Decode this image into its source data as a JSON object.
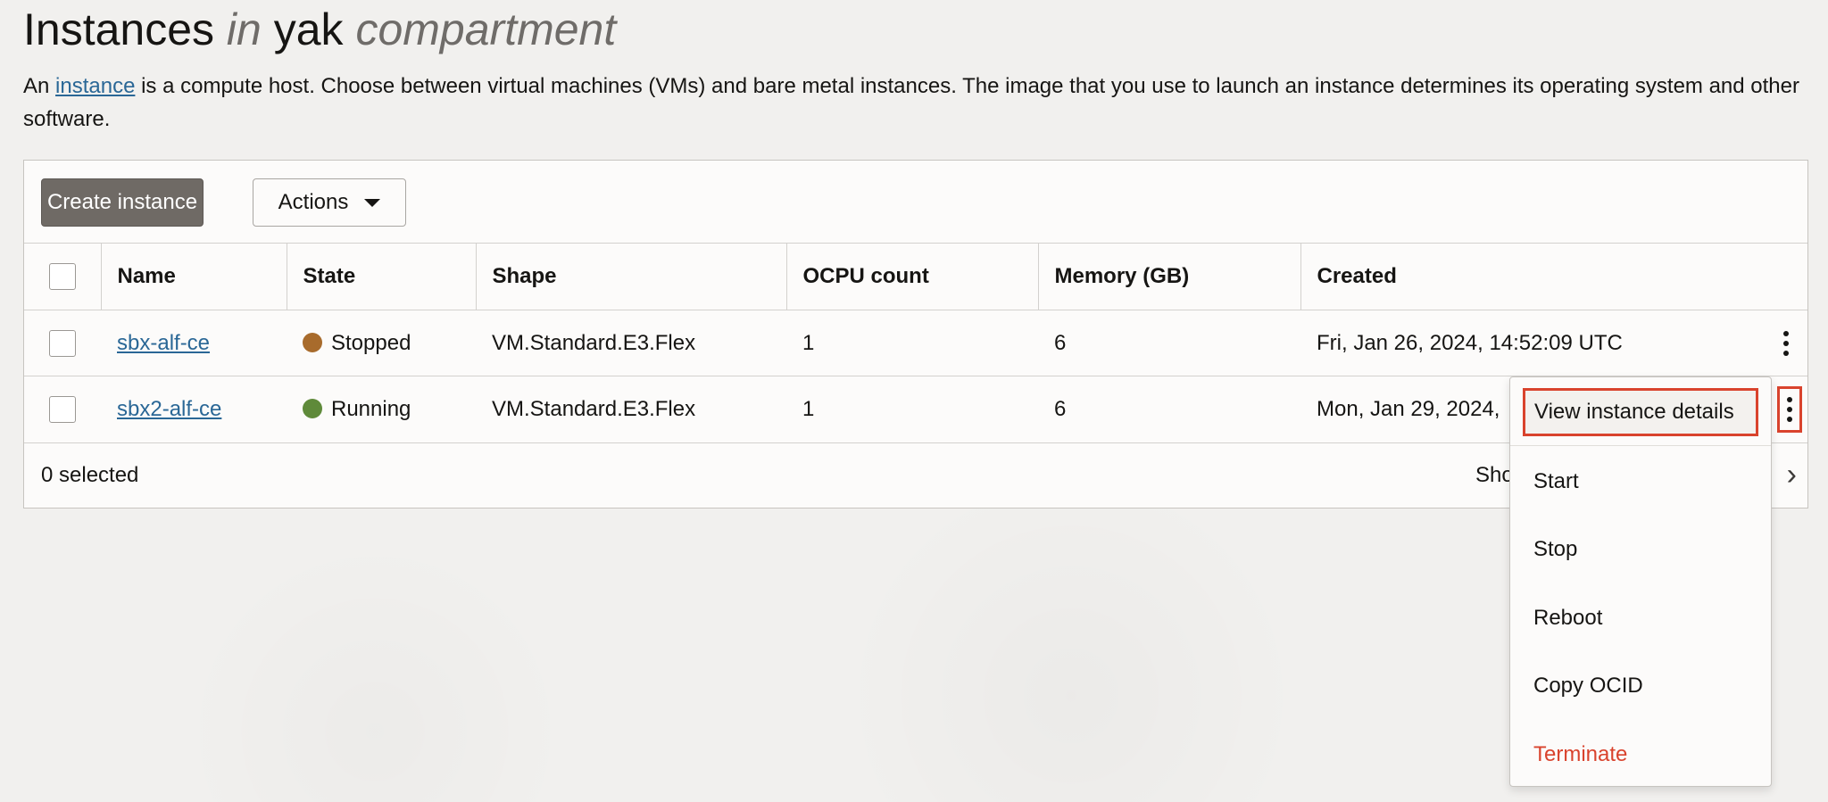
{
  "page": {
    "title_word1": "Instances",
    "title_in": "in",
    "title_name": "yak",
    "title_compartment": "compartment",
    "description_prefix": "An",
    "description_link": "instance",
    "description_rest": "is a compute host. Choose between virtual machines (VMs) and bare metal instances. The image that you use to launch an instance determines its operating system and other software."
  },
  "toolbar": {
    "create_label": "Create instance",
    "actions_label": "Actions"
  },
  "table": {
    "columns": [
      "Name",
      "State",
      "Shape",
      "OCPU count",
      "Memory (GB)",
      "Created"
    ],
    "rows": [
      {
        "name": "sbx-alf-ce",
        "state": "Stopped",
        "state_color": "#a86b2c",
        "shape": "VM.Standard.E3.Flex",
        "ocpu": "1",
        "memory": "6",
        "created": "Fri, Jan 26, 2024, 14:52:09 UTC"
      },
      {
        "name": "sbx2-alf-ce",
        "state": "Running",
        "state_color": "#5f8a3a",
        "shape": "VM.Standard.E3.Flex",
        "ocpu": "1",
        "memory": "6",
        "created": "Mon, Jan 29, 2024,"
      }
    ]
  },
  "footer": {
    "selected_text": "0 selected",
    "showing_text": "Sho"
  },
  "menu": {
    "items": [
      "View instance details",
      "Start",
      "Stop",
      "Reboot",
      "Copy OCID",
      "Terminate"
    ]
  },
  "colors": {
    "accent_link": "#2a6796",
    "highlight": "#d9432d",
    "primary_button": "#6f6a65"
  }
}
